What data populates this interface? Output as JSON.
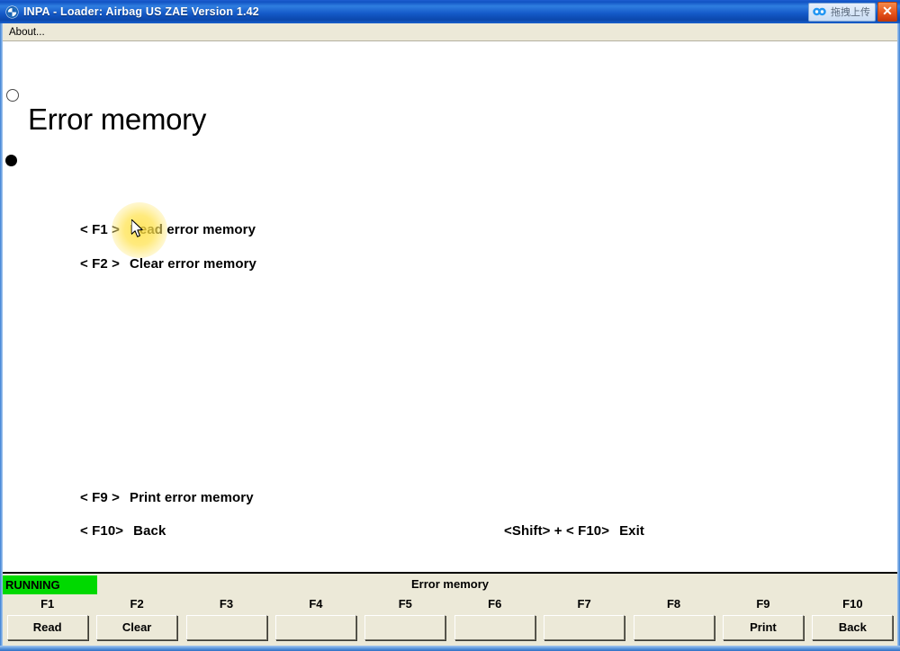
{
  "window": {
    "title": "INPA - Loader:  Airbag US ZAE Version 1.42",
    "logo_icon": "bmw-roundel-icon",
    "upload_badge_label": "拖拽上传",
    "upload_badge_icon": "cloud-upload-icon",
    "close_label": "✕"
  },
  "menu": {
    "items": [
      {
        "label": "About..."
      }
    ]
  },
  "content": {
    "page_title": "Error memory",
    "marker_circle_icon": "hollow-circle-marker-icon",
    "marker_dot_icon": "filled-dot-marker-icon",
    "cursor_icon": "arrow-cursor-icon",
    "highlight_icon": "click-highlight-icon",
    "menu_lines": [
      {
        "key": "< F1 >",
        "label": "Read error memory"
      },
      {
        "key": "< F2 >",
        "label": "Clear error memory"
      },
      {
        "key": "< F9 >",
        "label": "Print error memory"
      },
      {
        "key": "< F10>",
        "label": "Back"
      },
      {
        "key": "<Shift> + < F10>",
        "label": "Exit"
      }
    ]
  },
  "status": {
    "state_label": "RUNNING",
    "state_color": "#00d900",
    "title": "Error memory",
    "fkeys": [
      {
        "key": "F1",
        "label": "Read"
      },
      {
        "key": "F2",
        "label": "Clear"
      },
      {
        "key": "F3",
        "label": ""
      },
      {
        "key": "F4",
        "label": ""
      },
      {
        "key": "F5",
        "label": ""
      },
      {
        "key": "F6",
        "label": ""
      },
      {
        "key": "F7",
        "label": ""
      },
      {
        "key": "F8",
        "label": ""
      },
      {
        "key": "F9",
        "label": "Print"
      },
      {
        "key": "F10",
        "label": "Back"
      }
    ]
  },
  "colors": {
    "titlebar_blue": "#1459c8",
    "panel_bg": "#ffffff",
    "chrome_bg": "#ece9d8",
    "running_green": "#00d900",
    "highlight_yellow": "#ffde3c"
  }
}
